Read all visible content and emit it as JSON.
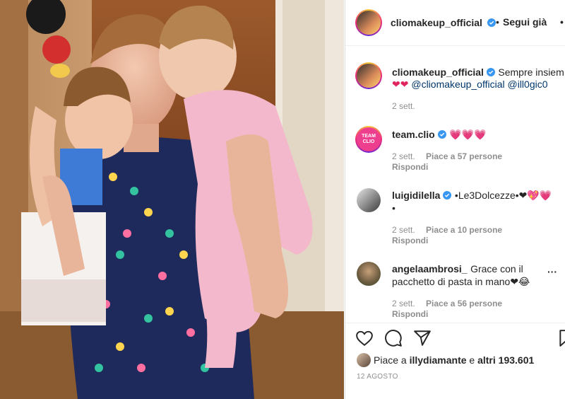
{
  "post": {
    "username": "cliomakeup_official",
    "dot": "•",
    "follow_label": "Segui già",
    "more": "•",
    "caption_text": "Sempre insiem",
    "caption_hearts": "❤❤",
    "caption_mention1": "@cliomakeup_official",
    "caption_mention2": "@ill0gic0",
    "caption_time": "2 sett."
  },
  "comments": [
    {
      "user": "team.clio",
      "avatar_text": "TEAM CLIO",
      "text": "💗💗💗",
      "time": "2 sett.",
      "likes": "Piace a 57 persone",
      "reply": "Rispondi"
    },
    {
      "user": "luigidilella",
      "text": "•Le3Dolcezze•❤💖💗",
      "text2": "•",
      "time": "2 sett.",
      "likes": "Piace a 10 persone",
      "reply": "Rispondi"
    },
    {
      "user": "angelaambrosi_",
      "text": "Grace con il",
      "text2": "pacchetto di pasta in mano❤😂",
      "time": "2 sett.",
      "likes": "Piace a 56 persone",
      "reply": "Rispondi",
      "more": "···"
    }
  ],
  "likes": {
    "prefix": "Piace a",
    "user": "illydiamante",
    "middle": "e",
    "others": "altri 193.601"
  },
  "date": "12 AGOSTO"
}
